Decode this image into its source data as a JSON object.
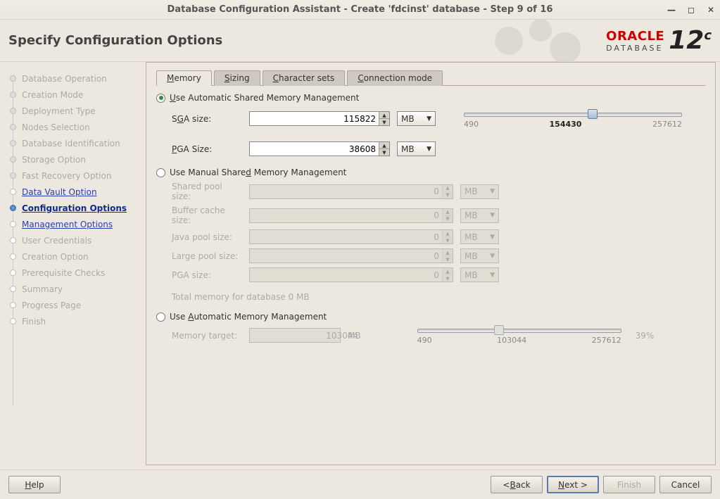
{
  "window": {
    "title": "Database Configuration Assistant - Create 'fdcinst' database - Step 9 of 16"
  },
  "header": {
    "heading": "Specify Configuration Options",
    "brand": "ORACLE",
    "brand2": "DATABASE",
    "ver": "12",
    "verC": "c"
  },
  "sidebar": {
    "items": [
      {
        "label": "Database Operation",
        "state": "done"
      },
      {
        "label": "Creation Mode",
        "state": "done"
      },
      {
        "label": "Deployment Type",
        "state": "done"
      },
      {
        "label": "Nodes Selection",
        "state": "done"
      },
      {
        "label": "Database Identification",
        "state": "done"
      },
      {
        "label": "Storage Option",
        "state": "done"
      },
      {
        "label": "Fast Recovery Option",
        "state": "done"
      },
      {
        "label": "Data Vault Option",
        "state": "link"
      },
      {
        "label": "Configuration Options",
        "state": "cur"
      },
      {
        "label": "Management Options",
        "state": "link"
      },
      {
        "label": "User Credentials",
        "state": "pending"
      },
      {
        "label": "Creation Option",
        "state": "pending"
      },
      {
        "label": "Prerequisite Checks",
        "state": "pending"
      },
      {
        "label": "Summary",
        "state": "pending"
      },
      {
        "label": "Progress Page",
        "state": "pending"
      },
      {
        "label": "Finish",
        "state": "pending"
      }
    ]
  },
  "tabs": [
    {
      "label": "Memory",
      "u": "M",
      "rest": "emory",
      "active": true
    },
    {
      "label": "Sizing",
      "u": "S",
      "rest": "izing"
    },
    {
      "label": "Character sets",
      "u": "C",
      "rest": "haracter sets"
    },
    {
      "label": "Connection mode",
      "u": "C",
      "rest": "onnection mode"
    }
  ],
  "memory": {
    "opt1": {
      "label": "Use Automatic Shared Memory Management",
      "u": "U",
      "rest": "se Automatic Shared Memory Management",
      "sel": true
    },
    "sga": {
      "label": "SGA size:",
      "u": "G",
      "prefix": "S",
      "suffix": "A size:",
      "value": "115822",
      "unit": "MB"
    },
    "pga": {
      "label": "PGA Size:",
      "u": "P",
      "suffix": "GA Size:",
      "value": "38608",
      "unit": "MB"
    },
    "slider": {
      "min": "490",
      "val": "154430",
      "max": "257612",
      "pos": 59
    },
    "opt2": {
      "label": "Use Manual Shared Memory Management",
      "sel": false,
      "prefix": "Use Manual Share",
      "u": "d",
      "suffix": " Memory Management"
    },
    "manual": [
      {
        "label": "Shared pool size:",
        "value": "0",
        "unit": "MB"
      },
      {
        "label": "Buffer cache size:",
        "value": "0",
        "unit": "MB"
      },
      {
        "label": "Java pool size:",
        "value": "0",
        "unit": "MB"
      },
      {
        "label": "Large pool size:",
        "value": "0",
        "unit": "MB"
      },
      {
        "label": "PGA size:",
        "value": "0",
        "unit": "MB"
      }
    ],
    "total": "Total memory for database 0 MB",
    "opt3": {
      "label": "Use Automatic Memory Management",
      "sel": false,
      "prefix": "Use ",
      "u": "A",
      "suffix": "utomatic Memory Management"
    },
    "target": {
      "label": "Memory target:",
      "value": "103044",
      "unit": "MB"
    },
    "slider2": {
      "min": "490",
      "val": "103044",
      "max": "257612",
      "pos": 40,
      "pct": "39%"
    }
  },
  "footer": {
    "help": "Help",
    "back": "< Back",
    "next": "Next >",
    "finish": "Finish",
    "cancel": "Cancel"
  }
}
